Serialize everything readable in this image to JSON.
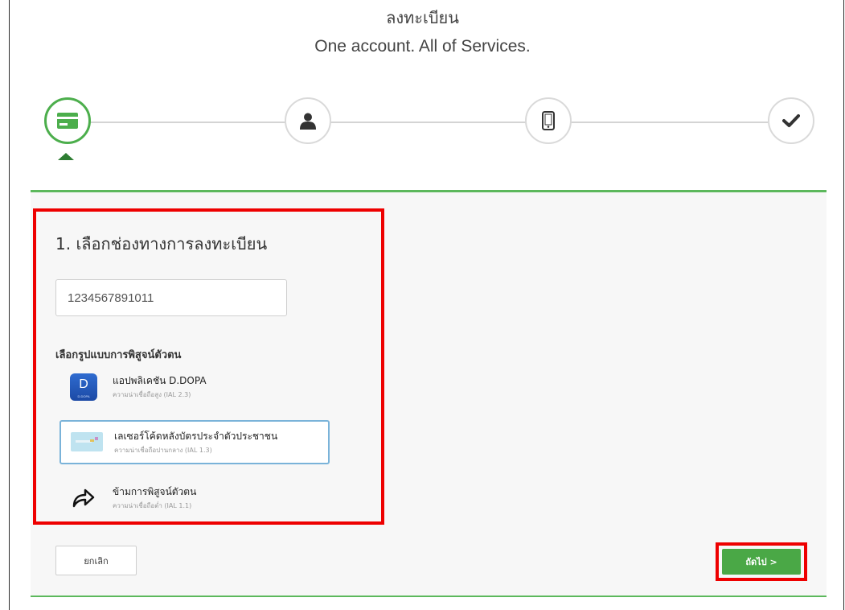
{
  "header": {
    "title": "ลงทะเบียน",
    "subtitle": "One account. All of Services."
  },
  "stepper": {
    "steps": [
      {
        "icon": "id-card-icon",
        "active": true
      },
      {
        "icon": "user-icon",
        "active": false
      },
      {
        "icon": "mobile-phone-icon",
        "active": false
      },
      {
        "icon": "checkmark-icon",
        "active": false
      }
    ],
    "active_color": "#4cae4c"
  },
  "form": {
    "section_title": "1. เลือกช่องทางการลงทะเบียน",
    "id_number": "1234567891011",
    "method_label": "เลือกรูปแบบการพิสูจน์ตัวตน",
    "options": [
      {
        "title": "แอปพลิเคชัน D.DOPA",
        "subtitle": "ความน่าเชื่อถือสูง (IAL 2.3)",
        "icon": "d-dopa-app-icon",
        "icon_letter": "D",
        "icon_caption": "D.DOPA",
        "selected": false
      },
      {
        "title": "เลเซอร์โค้ดหลังบัตรประจำตัวประชาชน",
        "subtitle": "ความน่าเชื่อถือปานกลาง (IAL 1.3)",
        "icon": "id-card-image-icon",
        "selected": true
      },
      {
        "title": "ข้ามการพิสูจน์ตัวตน",
        "subtitle": "ความน่าเชื่อถือต่ำ (IAL 1.1)",
        "icon": "skip-arrow-icon",
        "selected": false
      }
    ]
  },
  "actions": {
    "cancel_label": "ยกเลิก",
    "next_label": "ถัดไป >"
  },
  "colors": {
    "accent_green": "#5cb85c",
    "button_green": "#4aa846",
    "highlight_red": "#ee0000",
    "selected_border": "#7ab3d9"
  }
}
